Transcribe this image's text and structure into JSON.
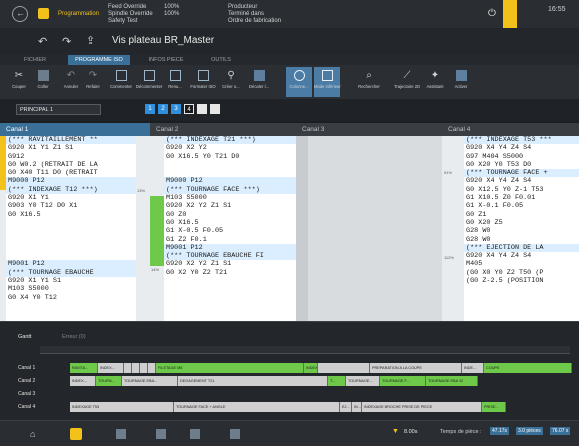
{
  "topbar": {
    "app_label": "Programmation",
    "feed_override_label": "Feed Override",
    "spindle_override_label": "Spindle Override",
    "safety_test_label": "Safety Test",
    "feed_override_value": "100%",
    "spindle_override_value": "100%",
    "producteur_label": "Producteur",
    "terminal_label": "Terminé dans",
    "ordre_label": "Ordre de fabrication",
    "clock": "16:55"
  },
  "titlebar": {
    "title": "Vis plateau BR_Master"
  },
  "tabs": [
    {
      "label": "FICHIER"
    },
    {
      "label": "PROGRAMME ISO"
    },
    {
      "label": "INFOS PIECE"
    },
    {
      "label": "OUTILS"
    }
  ],
  "ribbon": {
    "buttons": [
      {
        "label": "Couper",
        "icon": "scissors-icon"
      },
      {
        "label": "Coller",
        "icon": "paste-icon"
      },
      {
        "label": "Annuler",
        "icon": "undo-icon"
      },
      {
        "label": "Refaire",
        "icon": "redo-icon"
      },
      {
        "label": "Commenter",
        "icon": "comment-icon"
      },
      {
        "label": "Décommenter",
        "icon": "uncomment-icon"
      },
      {
        "label": "Renu...",
        "icon": "renumber-icon"
      },
      {
        "label": "Formater ISO",
        "icon": "format-icon"
      },
      {
        "label": "Créer o...",
        "icon": "pin-icon"
      },
      {
        "label": "Décaler l...",
        "icon": "shift-icon"
      },
      {
        "label": "Colonne...",
        "icon": "columns-icon"
      },
      {
        "label": "Mode inférieur",
        "icon": "lower-mode-icon"
      },
      {
        "label": "Rechercher",
        "icon": "search-icon"
      },
      {
        "label": "Trajectoire 2D",
        "icon": "trajectory-icon"
      },
      {
        "label": "Assistant",
        "icon": "wand-icon"
      },
      {
        "label": "Activer",
        "icon": "activate-icon"
      }
    ]
  },
  "channel_bar": {
    "select_value": "PRINCIPAL 1",
    "numbers": [
      "1",
      "2",
      "3",
      "4"
    ]
  },
  "columns": [
    {
      "header": "Canal 1",
      "lines": [
        "(*** RAVITAILLEMENT **",
        "G920 X1 Y1 Z1 S1",
        "G912",
        "G0 W0.2 (RETRAIT DE LA",
        "G0 X40 T11 D0 (RETRAIT",
        "M9000 P12",
        "(*** INDEXAGE T12 ***)",
        "G920 X1 Y1",
        "G903 Y0 T12 D0 X1",
        "G0 X16.5",
        "",
        "",
        "",
        "",
        "",
        "M9001 P12",
        "(*** TOURNAGE EBAUCHE",
        "G920 X1 Y1 S1",
        "M103 S5000",
        "G0 X4 Y0 T12"
      ]
    },
    {
      "header": "Canal 2",
      "lines": [
        "(*** INDEXAGE T21 ***)",
        "G920 X2 Y2",
        "G0 X16.5 Y0 T21 D0",
        "",
        "",
        "M9000 P12",
        "(*** TOURNAGE FACE ***)",
        "M103 S5000",
        "G920 X2 Y2 Z1 S1",
        "G0 Z0",
        "G0 X16.5",
        "G1 X-0.5 F0.05",
        "G1 Z2 F0.1",
        "M9001 P12",
        "(*** TOURNAGE EBAUCHE FI",
        "G920 X2 Y2 Z1 S1",
        "G0 X2 Y0 Z2 T21"
      ]
    },
    {
      "header": "Canal 3",
      "lines": []
    },
    {
      "header": "Canal 4",
      "lines": [
        "(*** INDEXAGE T53 ***",
        "G920 X4 Y4 Z4 S4",
        "G97 M404 S5000",
        "G0 X20 Y0 T53 D0",
        "(*** TOURNAGE FACE +",
        "G920 X4 Y4 Z4 S4",
        "G0 X12.5 Y0 Z-1 T53",
        "G1 X10.5 Z0 F0.01",
        "G1 X-0.1 F0.05",
        "G0 Z1",
        "G0 X20 Z5",
        "G28 W0",
        "G28 W0",
        "(*** EJECTION DE LA",
        "G920 X4 Y4 Z4 S4",
        "M405",
        "(G0 X0 Y0 Z2 T50 (P",
        "(G0 Z-2.5 (POSITION"
      ]
    }
  ],
  "side_labels": {
    "c1": "13%",
    "c2": "14%",
    "c4a": "91%",
    "c4b": "112%"
  },
  "gantt": {
    "tabs": [
      "Gantt",
      "Erreur (0)"
    ],
    "lanes": [
      {
        "label": "Canal 1",
        "segments": [
          {
            "t": "RAVITA...",
            "c": "g"
          },
          {
            "t": "INDEX...",
            "c": "l"
          },
          {
            "t": "",
            "c": "l"
          },
          {
            "t": "",
            "c": "l"
          },
          {
            "t": "",
            "c": "l"
          },
          {
            "t": "",
            "c": "l"
          },
          {
            "t": "FILETAGE M5",
            "c": "g"
          },
          {
            "t": "INDEX...",
            "c": "g"
          },
          {
            "t": "",
            "c": "l"
          },
          {
            "t": "PREPARATION A LA COUPE",
            "c": "l"
          },
          {
            "t": "INDE...",
            "c": "l"
          },
          {
            "t": "COUPE",
            "c": "g"
          }
        ]
      },
      {
        "label": "Canal 2",
        "segments": [
          {
            "t": "INDEX...",
            "c": "l"
          },
          {
            "t": "TOURN...",
            "c": "g"
          },
          {
            "t": "TOURNAGE EBA...",
            "c": "l"
          },
          {
            "t": "DEGAGEMENT T21",
            "c": "l"
          },
          {
            "t": "T...",
            "c": "g"
          },
          {
            "t": "TOURNAGE...",
            "c": "l"
          },
          {
            "t": "TOURNAGE F...",
            "c": "g"
          },
          {
            "t": "TOURNAGE EBA 12",
            "c": "g"
          }
        ]
      },
      {
        "label": "Canal 3",
        "segments": []
      },
      {
        "label": "Canal 4",
        "segments": [
          {
            "t": "INDEXAGE T53",
            "c": "l"
          },
          {
            "t": "TOURNAGE FACE + ANGLE",
            "c": "l"
          },
          {
            "t": "EJ...",
            "c": "l"
          },
          {
            "t": "IN...",
            "c": "l"
          },
          {
            "t": "INDEXAGE BROCHE PRISE DE PIECE",
            "c": "l"
          },
          {
            "t": "PRISE...",
            "c": "g"
          }
        ]
      }
    ],
    "footer_time_label": "8.00s",
    "footer_piece_label": "Temps de pièce :",
    "footer_piece_value": "47.17s",
    "footer_extra": "3.0 pièces",
    "footer_extra2": "76.07 s"
  },
  "colors": {
    "accent": "#f2c21a",
    "blue": "#2f8fdc",
    "green": "#6ec84a"
  }
}
